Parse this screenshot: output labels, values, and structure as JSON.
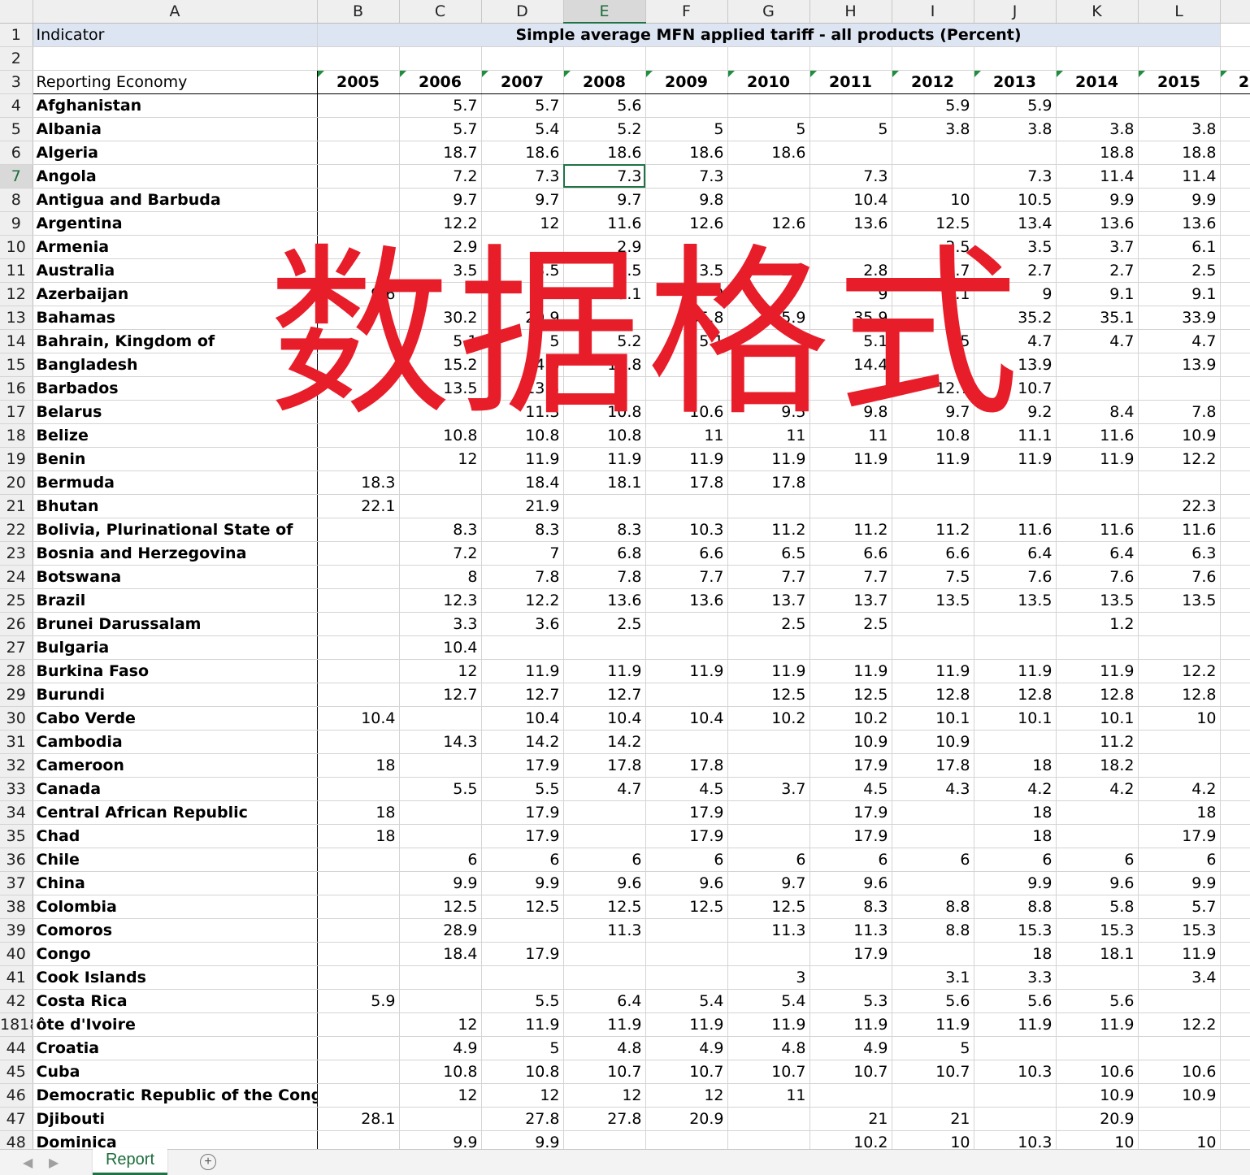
{
  "columns": [
    "",
    "A",
    "B",
    "C",
    "D",
    "E",
    "F",
    "G",
    "H",
    "I",
    "J",
    "K",
    "L",
    ""
  ],
  "selected_column": "E",
  "row1": {
    "num": "1",
    "label": "Indicator",
    "title": "Simple average MFN applied tariff - all products (Percent)"
  },
  "row2": {
    "num": "2"
  },
  "row3": {
    "num": "3",
    "label": "Reporting Economy",
    "years": [
      "2005",
      "2006",
      "2007",
      "2008",
      "2009",
      "2010",
      "2011",
      "2012",
      "2013",
      "2014",
      "2015",
      "2"
    ]
  },
  "rows": [
    [
      "4",
      "Afghanistan",
      "",
      "5.7",
      "5.7",
      "5.6",
      "",
      "",
      "",
      "5.9",
      "5.9",
      "",
      ""
    ],
    [
      "5",
      "Albania",
      "",
      "5.7",
      "5.4",
      "5.2",
      "5",
      "5",
      "5",
      "3.8",
      "3.8",
      "3.8",
      "3.8"
    ],
    [
      "6",
      "Algeria",
      "",
      "18.7",
      "18.6",
      "18.6",
      "18.6",
      "18.6",
      "",
      "",
      "",
      "18.8",
      "18.8"
    ],
    [
      "7",
      "Angola",
      "",
      "7.2",
      "7.3",
      "7.3",
      "7.3",
      "",
      "7.3",
      "",
      "7.3",
      "11.4",
      "11.4"
    ],
    [
      "8",
      "Antigua and Barbuda",
      "",
      "9.7",
      "9.7",
      "9.7",
      "9.8",
      "",
      "10.4",
      "10",
      "10.5",
      "9.9",
      "9.9"
    ],
    [
      "9",
      "Argentina",
      "",
      "12.2",
      "12",
      "11.6",
      "12.6",
      "12.6",
      "13.6",
      "12.5",
      "13.4",
      "13.6",
      "13.6"
    ],
    [
      "10",
      "Armenia",
      "",
      "2.9",
      "",
      "2.9",
      "",
      "",
      "",
      "3.5",
      "3.5",
      "3.7",
      "6.1"
    ],
    [
      "11",
      "Australia",
      "",
      "3.5",
      "3.5",
      "3.5",
      "3.5",
      "2.8",
      "2.8",
      "2.7",
      "2.7",
      "2.7",
      "2.5"
    ],
    [
      "12",
      "Azerbaijan",
      "9.6",
      "",
      "9.2",
      "9.1",
      "9",
      "",
      "9",
      "9.1",
      "9",
      "9.1",
      "9.1"
    ],
    [
      "13",
      "Bahamas",
      "",
      "30.2",
      "29.9",
      "",
      "35.8",
      "35.9",
      "35.9",
      "",
      "35.2",
      "35.1",
      "33.9"
    ],
    [
      "14",
      "Bahrain, Kingdom of",
      "",
      "5.1",
      "5",
      "5.2",
      "5.1",
      "",
      "5.1",
      "5",
      "4.7",
      "4.7",
      "4.7"
    ],
    [
      "15",
      "Bangladesh",
      "",
      "15.2",
      "14.8",
      "14.8",
      "",
      "",
      "14.4",
      "",
      "13.9",
      "",
      "13.9"
    ],
    [
      "16",
      "Barbados",
      "",
      "13.5",
      "13.5",
      "",
      "",
      "",
      "",
      "12.7",
      "10.7",
      "",
      ""
    ],
    [
      "17",
      "Belarus",
      "",
      "",
      "11.3",
      "10.8",
      "10.6",
      "9.5",
      "9.8",
      "9.7",
      "9.2",
      "8.4",
      "7.8"
    ],
    [
      "18",
      "Belize",
      "",
      "10.8",
      "10.8",
      "10.8",
      "11",
      "11",
      "11",
      "10.8",
      "11.1",
      "11.6",
      "10.9"
    ],
    [
      "19",
      "Benin",
      "",
      "12",
      "11.9",
      "11.9",
      "11.9",
      "11.9",
      "11.9",
      "11.9",
      "11.9",
      "11.9",
      "12.2"
    ],
    [
      "20",
      "Bermuda",
      "18.3",
      "",
      "18.4",
      "18.1",
      "17.8",
      "17.8",
      "",
      "",
      "",
      "",
      ""
    ],
    [
      "21",
      "Bhutan",
      "22.1",
      "",
      "21.9",
      "",
      "",
      "",
      "",
      "",
      "",
      "",
      "22.3"
    ],
    [
      "22",
      "Bolivia, Plurinational State of",
      "",
      "8.3",
      "8.3",
      "8.3",
      "10.3",
      "11.2",
      "11.2",
      "11.2",
      "11.6",
      "11.6",
      "11.6"
    ],
    [
      "23",
      "Bosnia and Herzegovina",
      "",
      "7.2",
      "7",
      "6.8",
      "6.6",
      "6.5",
      "6.6",
      "6.6",
      "6.4",
      "6.4",
      "6.3"
    ],
    [
      "24",
      "Botswana",
      "",
      "8",
      "7.8",
      "7.8",
      "7.7",
      "7.7",
      "7.7",
      "7.5",
      "7.6",
      "7.6",
      "7.6"
    ],
    [
      "25",
      "Brazil",
      "",
      "12.3",
      "12.2",
      "13.6",
      "13.6",
      "13.7",
      "13.7",
      "13.5",
      "13.5",
      "13.5",
      "13.5"
    ],
    [
      "26",
      "Brunei Darussalam",
      "",
      "3.3",
      "3.6",
      "2.5",
      "",
      "2.5",
      "2.5",
      "",
      "",
      "1.2",
      ""
    ],
    [
      "27",
      "Bulgaria",
      "",
      "10.4",
      "",
      "",
      "",
      "",
      "",
      "",
      "",
      "",
      ""
    ],
    [
      "28",
      "Burkina Faso",
      "",
      "12",
      "11.9",
      "11.9",
      "11.9",
      "11.9",
      "11.9",
      "11.9",
      "11.9",
      "11.9",
      "12.2"
    ],
    [
      "29",
      "Burundi",
      "",
      "12.7",
      "12.7",
      "12.7",
      "",
      "12.5",
      "12.5",
      "12.8",
      "12.8",
      "12.8",
      "12.8"
    ],
    [
      "30",
      "Cabo Verde",
      "10.4",
      "",
      "10.4",
      "10.4",
      "10.4",
      "10.2",
      "10.2",
      "10.1",
      "10.1",
      "10.1",
      "10"
    ],
    [
      "31",
      "Cambodia",
      "",
      "14.3",
      "14.2",
      "14.2",
      "",
      "",
      "10.9",
      "10.9",
      "",
      "11.2",
      ""
    ],
    [
      "32",
      "Cameroon",
      "18",
      "",
      "17.9",
      "17.8",
      "17.8",
      "",
      "17.9",
      "17.8",
      "18",
      "18.2",
      ""
    ],
    [
      "33",
      "Canada",
      "",
      "5.5",
      "5.5",
      "4.7",
      "4.5",
      "3.7",
      "4.5",
      "4.3",
      "4.2",
      "4.2",
      "4.2"
    ],
    [
      "34",
      "Central African Republic",
      "18",
      "",
      "17.9",
      "",
      "17.9",
      "",
      "17.9",
      "",
      "18",
      "",
      "18"
    ],
    [
      "35",
      "Chad",
      "18",
      "",
      "17.9",
      "",
      "17.9",
      "",
      "17.9",
      "",
      "18",
      "",
      "17.9"
    ],
    [
      "36",
      "Chile",
      "",
      "6",
      "6",
      "6",
      "6",
      "6",
      "6",
      "6",
      "6",
      "6",
      "6"
    ],
    [
      "37",
      "China",
      "",
      "9.9",
      "9.9",
      "9.6",
      "9.6",
      "9.7",
      "9.6",
      "",
      "9.9",
      "9.6",
      "9.9"
    ],
    [
      "38",
      "Colombia",
      "",
      "12.5",
      "12.5",
      "12.5",
      "12.5",
      "12.5",
      "8.3",
      "8.8",
      "8.8",
      "5.8",
      "5.7"
    ],
    [
      "39",
      "Comoros",
      "",
      "28.9",
      "",
      "11.3",
      "",
      "11.3",
      "11.3",
      "8.8",
      "15.3",
      "15.3",
      "15.3"
    ],
    [
      "40",
      "Congo",
      "",
      "18.4",
      "17.9",
      "",
      "",
      "",
      "17.9",
      "",
      "18",
      "18.1",
      "11.9"
    ],
    [
      "41",
      "Cook Islands",
      "",
      "",
      "",
      "",
      "",
      "3",
      "",
      "3.1",
      "3.3",
      "",
      "3.4"
    ],
    [
      "42",
      "Costa Rica",
      "5.9",
      "",
      "5.5",
      "6.4",
      "5.4",
      "5.4",
      "5.3",
      "5.6",
      "5.6",
      "5.6",
      ""
    ],
    [
      "1818",
      "ôte d'Ivoire",
      "",
      "12",
      "11.9",
      "11.9",
      "11.9",
      "11.9",
      "11.9",
      "11.9",
      "11.9",
      "11.9",
      "12.2"
    ],
    [
      "44",
      "Croatia",
      "",
      "4.9",
      "5",
      "4.8",
      "4.9",
      "4.8",
      "4.9",
      "5",
      "",
      "",
      ""
    ],
    [
      "45",
      "Cuba",
      "",
      "10.8",
      "10.8",
      "10.7",
      "10.7",
      "10.7",
      "10.7",
      "10.7",
      "10.3",
      "10.6",
      "10.6"
    ],
    [
      "46",
      "Democratic Republic of the Congo",
      "",
      "12",
      "12",
      "12",
      "12",
      "11",
      "",
      "",
      "",
      "10.9",
      "10.9"
    ],
    [
      "47",
      "Djibouti",
      "28.1",
      "",
      "27.8",
      "27.8",
      "20.9",
      "",
      "21",
      "21",
      "",
      "20.9",
      ""
    ],
    [
      "48",
      "Dominica",
      "",
      "9.9",
      "9.9",
      "",
      "",
      "",
      "10.2",
      "10",
      "10.3",
      "10",
      "10"
    ]
  ],
  "watermark": "数据格式",
  "tabbar": {
    "prev": "◀",
    "next": "▶",
    "sheet_name": "Report",
    "add": "+"
  }
}
